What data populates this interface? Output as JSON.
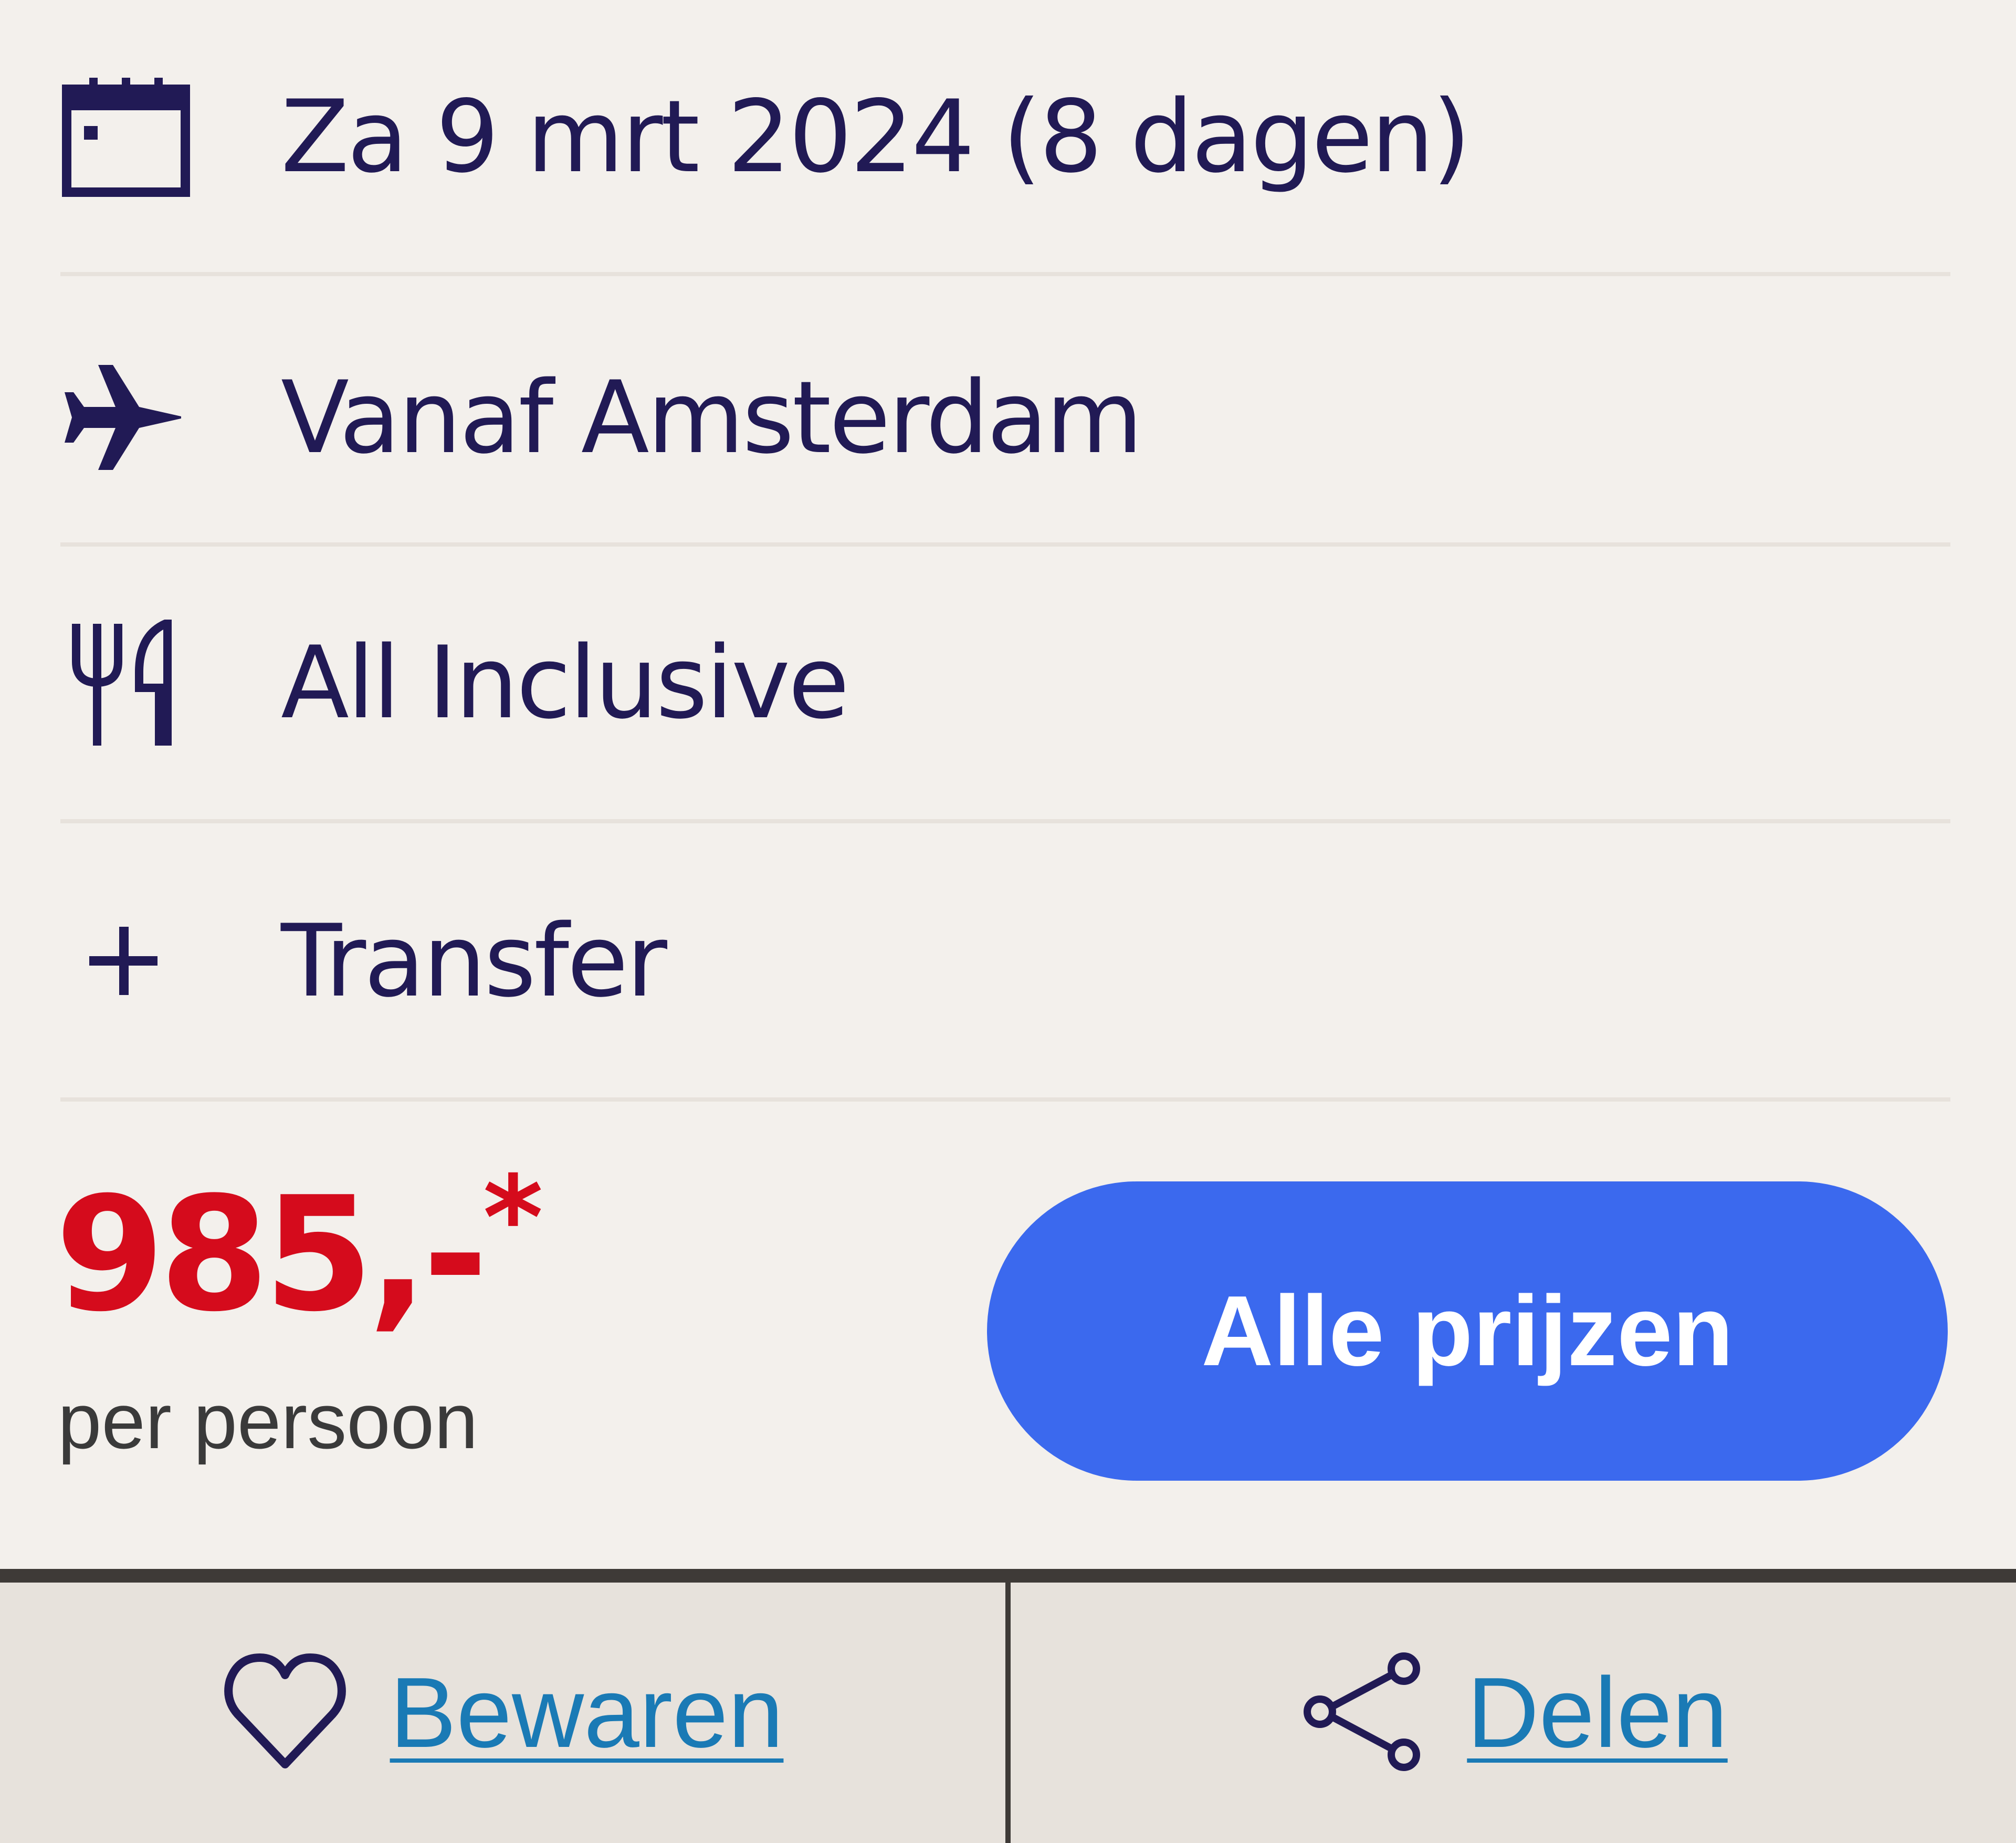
{
  "details": {
    "date": "Za 9 mrt 2024 (8 dagen)",
    "departure": "Vanaf Amsterdam",
    "board": "All Inclusive",
    "extra": "Transfer"
  },
  "price": {
    "amount": "985,-",
    "asterisk": "*",
    "unit": "per persoon"
  },
  "cta": {
    "label": "Alle prijzen"
  },
  "footer": {
    "save_label": "Bewaren",
    "share_label": "Delen"
  },
  "colors": {
    "text": "#211a55",
    "price": "#d50b1c",
    "button": "#3b69ee",
    "link": "#1a7ab5"
  }
}
